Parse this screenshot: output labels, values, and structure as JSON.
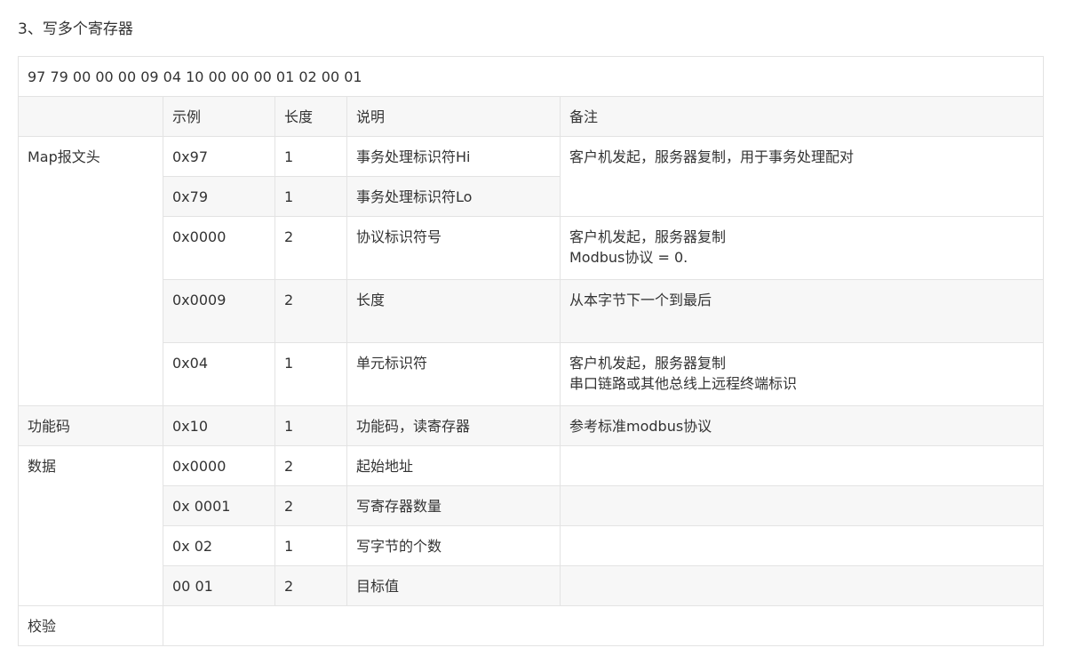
{
  "heading": "3、写多个寄存器",
  "hex_frame": "97 79 00 00 00 09 04 10 00 00 00 01 02 00 01",
  "headers": {
    "col0": "",
    "example": "示例",
    "length": "长度",
    "desc": "说明",
    "note": "备注"
  },
  "groups": {
    "header": "Map报文头",
    "function": "功能码",
    "data": "数据",
    "checksum": "校验"
  },
  "rows": [
    {
      "example": "0x97",
      "length": "1",
      "desc": "事务处理标识符Hi"
    },
    {
      "example": "0x79",
      "length": "1",
      "desc": "事务处理标识符Lo"
    },
    {
      "example": "0x0000",
      "length": "2",
      "desc": "协议标识符号"
    },
    {
      "example": "0x0009",
      "length": "2",
      "desc": "长度"
    },
    {
      "example": "0x04",
      "length": "1",
      "desc": "单元标识符"
    },
    {
      "example": "0x10",
      "length": "1",
      "desc": "功能码，读寄存器"
    },
    {
      "example": "0x0000",
      "length": "2",
      "desc": "起始地址"
    },
    {
      "example": "0x 0001",
      "length": "2",
      "desc": "写寄存器数量"
    },
    {
      "example": "0x 02",
      "length": "1",
      "desc": "写字节的个数"
    },
    {
      "example": "00 01",
      "length": "2",
      "desc": "目标值"
    }
  ],
  "notes": {
    "transaction": "客户机发起，服务器复制，用于事务处理配对",
    "protocol_line1": "客户机发起，服务器复制",
    "protocol_line2": "Modbus协议 = 0.",
    "length": "从本字节下一个到最后",
    "unit_line1": "客户机发起，服务器复制",
    "unit_line2": "串口链路或其他总线上远程终端标识",
    "function": "参考标准modbus协议"
  }
}
